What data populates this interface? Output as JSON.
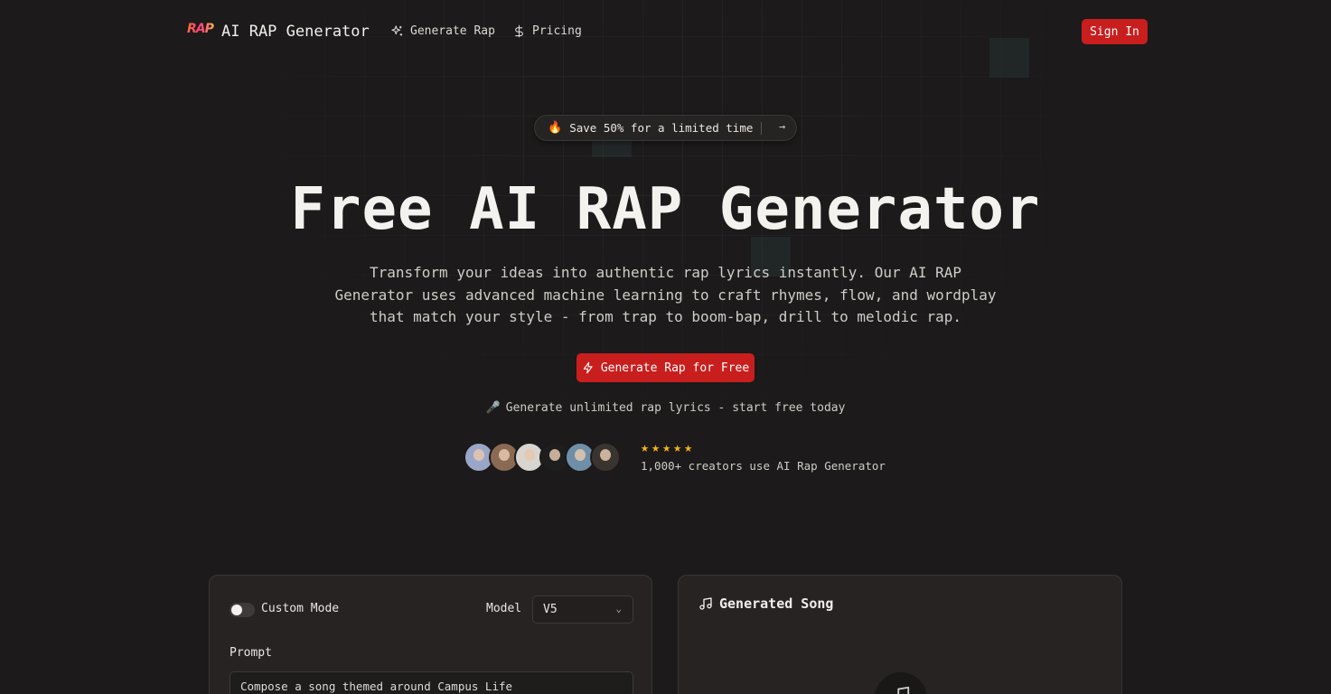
{
  "nav": {
    "logo_text": "RAP",
    "brand": "AI RAP Generator",
    "links": [
      {
        "label": "Generate Rap",
        "icon": "sparkles-icon"
      },
      {
        "label": "Pricing",
        "icon": "dollar-icon"
      }
    ],
    "signin_label": "Sign In"
  },
  "promo": {
    "icon": "fire-icon",
    "text": "Save 50% for a limited time",
    "arrow": "→"
  },
  "hero": {
    "title": "Free AI RAP Generator",
    "subtitle": "Transform your ideas into authentic rap lyrics instantly. Our AI RAP Generator uses advanced machine learning to craft rhymes, flow, and wordplay that match your style - from trap to boom-bap, drill to melodic rap.",
    "cta_label": "Generate Rap for Free",
    "tagline": "Generate unlimited rap lyrics - start free today",
    "rating_stars": 5,
    "creators_text": "1,000+ creators use AI Rap Generator"
  },
  "avatars": [
    {
      "bg": "#9aa6c8"
    },
    {
      "bg": "#8a6a52"
    },
    {
      "bg": "#d8d4d0"
    },
    {
      "bg": "#1e1e1e"
    },
    {
      "bg": "#6f8fa8"
    },
    {
      "bg": "#3a3430"
    }
  ],
  "form": {
    "custom_mode_label": "Custom Mode",
    "custom_mode_on": false,
    "model_label": "Model",
    "model_value": "V5",
    "prompt_label": "Prompt",
    "prompt_value": "Compose a song themed around Campus Life"
  },
  "output": {
    "title": "Generated Song"
  },
  "colors": {
    "accent": "#c81e1e",
    "background": "#1c1a1a",
    "star": "#f5b316"
  }
}
